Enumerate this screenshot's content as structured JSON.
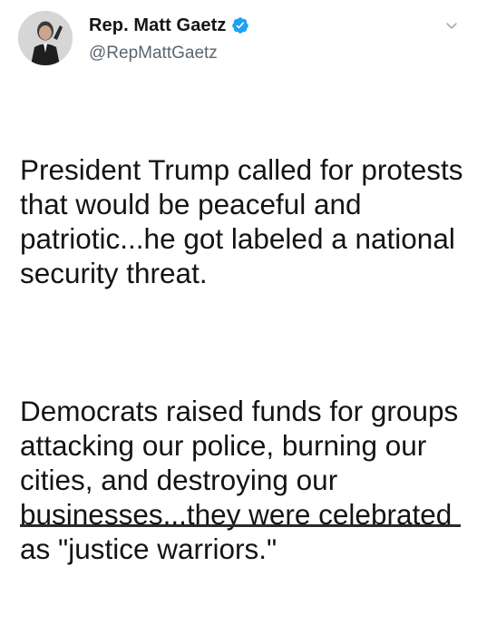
{
  "author": {
    "display_name": "Rep. Matt Gaetz",
    "handle": "@RepMattGaetz",
    "verified": true,
    "avatar_icon": "profile-avatar",
    "menu_icon": "chevron-down-icon"
  },
  "tweet": {
    "paragraphs": [
      "President Trump called for protests that would be peaceful and patriotic...he got labeled a national security threat.",
      "Democrats raised funds for groups attacking our police, burning our cities, and destroying our businesses...they were celebrated as \"justice warriors.\""
    ]
  },
  "colors": {
    "verified_badge": "#1da1f2",
    "handle": "#5b6670",
    "text": "#141414"
  }
}
